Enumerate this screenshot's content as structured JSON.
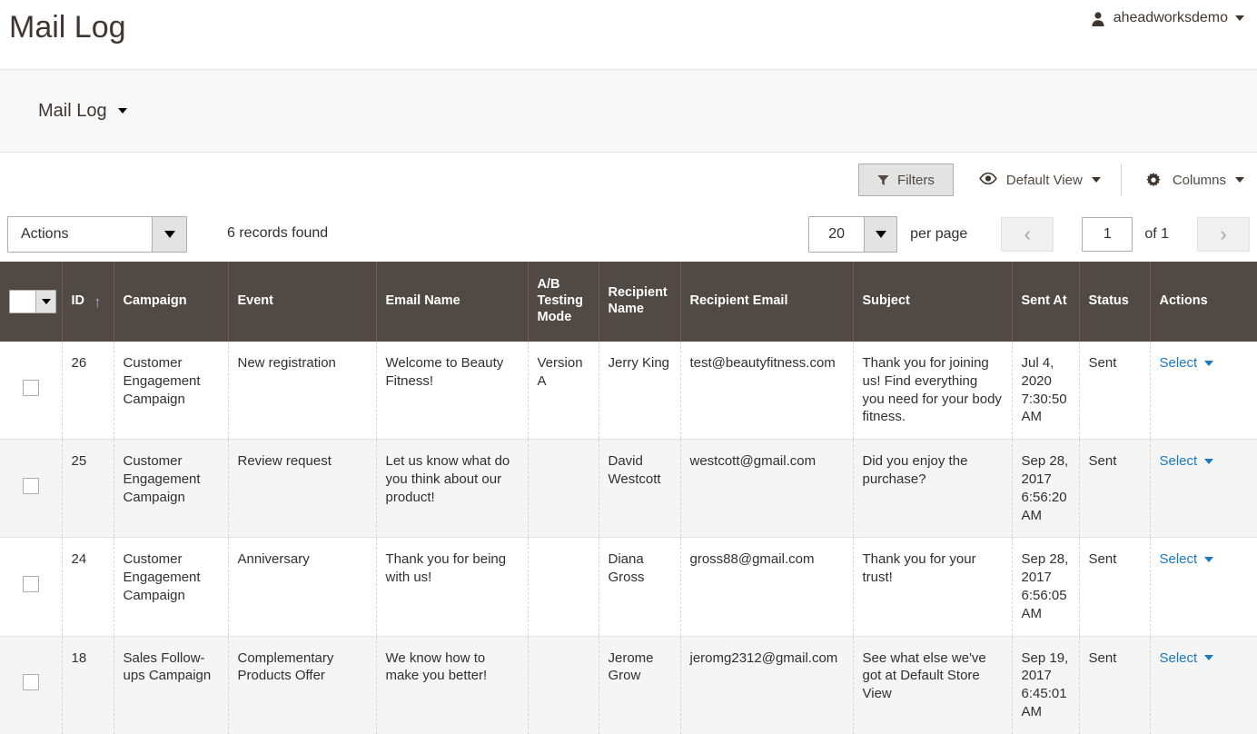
{
  "header": {
    "title": "Mail Log",
    "user": {
      "name": "aheadworksdemo",
      "avatar_icon": "user-avatar-icon",
      "caret_icon": "chevron-down-icon"
    }
  },
  "bookmarks": {
    "active_label": "Mail Log",
    "caret_icon": "chevron-down-icon"
  },
  "toolbar": {
    "filters_label": "Filters",
    "filters_icon": "funnel-icon",
    "view_label": "Default View",
    "view_icon": "eye-icon",
    "columns_label": "Columns",
    "columns_icon": "gear-icon"
  },
  "grid_actions": {
    "actions_label": "Actions",
    "records_found": "6 records found"
  },
  "pager": {
    "per_page_value": "20",
    "per_page_label": "per page",
    "prev_icon": "chevron-left-icon",
    "next_icon": "chevron-right-icon",
    "current_page": "1",
    "of_label": "of 1"
  },
  "grid": {
    "columns": [
      {
        "key": "check",
        "label": ""
      },
      {
        "key": "id",
        "label": "ID",
        "sorted": "asc",
        "sort_icon": "arrow-up-icon"
      },
      {
        "key": "campaign",
        "label": "Campaign"
      },
      {
        "key": "event",
        "label": "Event"
      },
      {
        "key": "email_name",
        "label": "Email Name"
      },
      {
        "key": "ab_testing_mode",
        "label": "A/B Testing Mode"
      },
      {
        "key": "recipient_name",
        "label": "Recipient Name"
      },
      {
        "key": "recipient_email",
        "label": "Recipient Email"
      },
      {
        "key": "subject",
        "label": "Subject"
      },
      {
        "key": "sent_at",
        "label": "Sent At"
      },
      {
        "key": "status",
        "label": "Status"
      },
      {
        "key": "actions",
        "label": "Actions"
      }
    ],
    "action_label": "Select",
    "rows": [
      {
        "id": "26",
        "campaign": "Customer Engagement Campaign",
        "event": "New registration",
        "email_name": "Welcome to Beauty Fitness!",
        "ab_testing_mode": "Version A",
        "recipient_name": "Jerry King",
        "recipient_email": "test@beautyfitness.com",
        "subject": "Thank you for joining us! Find everything you need for your body fitness.",
        "sent_at": "Jul 4, 2020 7:30:50 AM",
        "status": "Sent",
        "action": "Select"
      },
      {
        "id": "25",
        "campaign": "Customer Engagement Campaign",
        "event": "Review request",
        "email_name": "Let us know what do you think about our product!",
        "ab_testing_mode": "",
        "recipient_name": "David Westcott",
        "recipient_email": "westcott@gmail.com",
        "subject": "Did you enjoy the purchase?",
        "sent_at": "Sep 28, 2017 6:56:20 AM",
        "status": "Sent",
        "action": "Select"
      },
      {
        "id": "24",
        "campaign": "Customer Engagement Campaign",
        "event": "Anniversary",
        "email_name": "Thank you for being with us!",
        "ab_testing_mode": "",
        "recipient_name": "Diana Gross",
        "recipient_email": "gross88@gmail.com",
        "subject": "Thank you for your trust!",
        "sent_at": "Sep 28, 2017 6:56:05 AM",
        "status": "Sent",
        "action": "Select"
      },
      {
        "id": "18",
        "campaign": "Sales Follow-ups Campaign",
        "event": "Complementary Products Offer",
        "email_name": "We know how to make you better!",
        "ab_testing_mode": "",
        "recipient_name": "Jerome Grow",
        "recipient_email": "jeromg2312@gmail.com",
        "subject": "See what else we've got at Default Store View",
        "sent_at": "Sep 19, 2017 6:45:01 AM",
        "status": "Sent",
        "action": "Select"
      }
    ]
  },
  "colors": {
    "header_row_bg": "#514943",
    "link": "#1979c3",
    "page_bg": "#ffffff",
    "alt_row_bg": "#f5f5f5",
    "bookmark_bar_bg": "#f8f8f8",
    "sort_arrow": "#9db7c8"
  }
}
